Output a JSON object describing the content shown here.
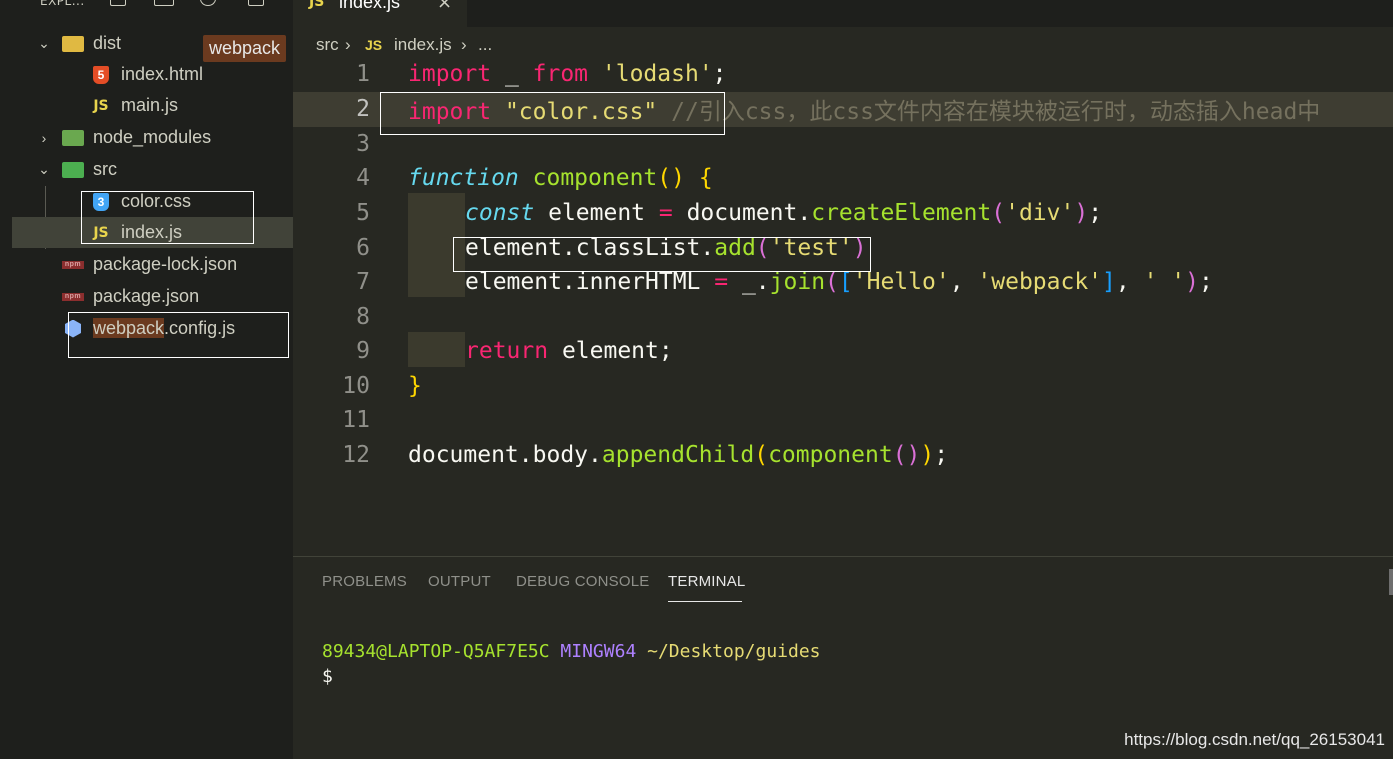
{
  "sidebar": {
    "title": "EXPL...",
    "tooltip": "webpack",
    "items": [
      {
        "label": "dist",
        "type": "folder-open"
      },
      {
        "label": "index.html",
        "type": "html"
      },
      {
        "label": "main.js",
        "type": "js"
      },
      {
        "label": "node_modules",
        "type": "folder-closed"
      },
      {
        "label": "src",
        "type": "folder-open"
      },
      {
        "label": "color.css",
        "type": "css"
      },
      {
        "label": "index.js",
        "type": "js"
      },
      {
        "label": "package-lock.json",
        "type": "npm"
      },
      {
        "label": "package.json",
        "type": "npm"
      },
      {
        "label_highlight": "webpack",
        "label_rest": ".config.js",
        "type": "webpack"
      }
    ],
    "icon_text": {
      "js": "JS",
      "html": "5",
      "css": "3",
      "npm": "npm"
    }
  },
  "tab": {
    "label": "index.js",
    "icon": "JS",
    "close": "×"
  },
  "breadcrumb": {
    "part1": "src",
    "sep": "›",
    "file_icon": "JS",
    "file": "index.js",
    "more": "..."
  },
  "editor": {
    "line_numbers": [
      "1",
      "2",
      "3",
      "4",
      "5",
      "6",
      "7",
      "8",
      "9",
      "10",
      "11",
      "12"
    ],
    "lines": {
      "l1": {
        "kw1": "import",
        "t1": " _ ",
        "kw2": "from",
        "t2": " ",
        "str": "'lodash'",
        "t3": ";"
      },
      "l2": {
        "kw": "import",
        "t1": " ",
        "str": "\"color.css\"",
        "t2": " ",
        "cmt": "//引入css，此css文件内容在模块被运行时，动态插入head中"
      },
      "l4": {
        "kw": "function",
        "t1": " ",
        "fn": "component",
        "b1": "(",
        "b2": ")",
        "t2": " ",
        "b3": "{"
      },
      "l5": {
        "kw": "const",
        "t1": " element ",
        "op": "=",
        "t2": " document.",
        "fn": "createElement",
        "b1": "(",
        "str": "'div'",
        "b2": ")",
        "t3": ";"
      },
      "l6": {
        "t1": "element.classList.",
        "fn": "add",
        "b1": "(",
        "str": "'test'",
        "b2": ")"
      },
      "l7": {
        "t1": "element.innerHTML ",
        "op": "=",
        "t2": " _.",
        "fn": "join",
        "b1": "(",
        "b2": "[",
        "s1": "'Hello'",
        "c1": ", ",
        "s2": "'webpack'",
        "b3": "]",
        "c2": ", ",
        "s3": "' '",
        "b4": ")",
        "t3": ";"
      },
      "l9": {
        "kw": "return",
        "t1": " element;"
      },
      "l10": {
        "b1": "}"
      },
      "l12": {
        "t1": "document.body.",
        "fn1": "appendChild",
        "b1": "(",
        "fn2": "component",
        "b2": "(",
        "b3": ")",
        "b4": ")",
        "t2": ";"
      }
    }
  },
  "panel": {
    "tabs": [
      "PROBLEMS",
      "OUTPUT",
      "DEBUG CONSOLE",
      "TERMINAL"
    ],
    "terminal": {
      "user": "89434@LAPTOP-Q5AF7E5C",
      "host": "MINGW64",
      "path": "~/Desktop/guides",
      "prompt": "$"
    }
  },
  "watermark": "https://blog.csdn.net/qq_26153041",
  "colors": {
    "bg": "#272822",
    "sidebar": "#1e1f1c",
    "keyword": "#f92672",
    "string": "#e6db74",
    "function": "#a6e22e",
    "storage": "#66d9ef",
    "comment": "#75715e"
  }
}
